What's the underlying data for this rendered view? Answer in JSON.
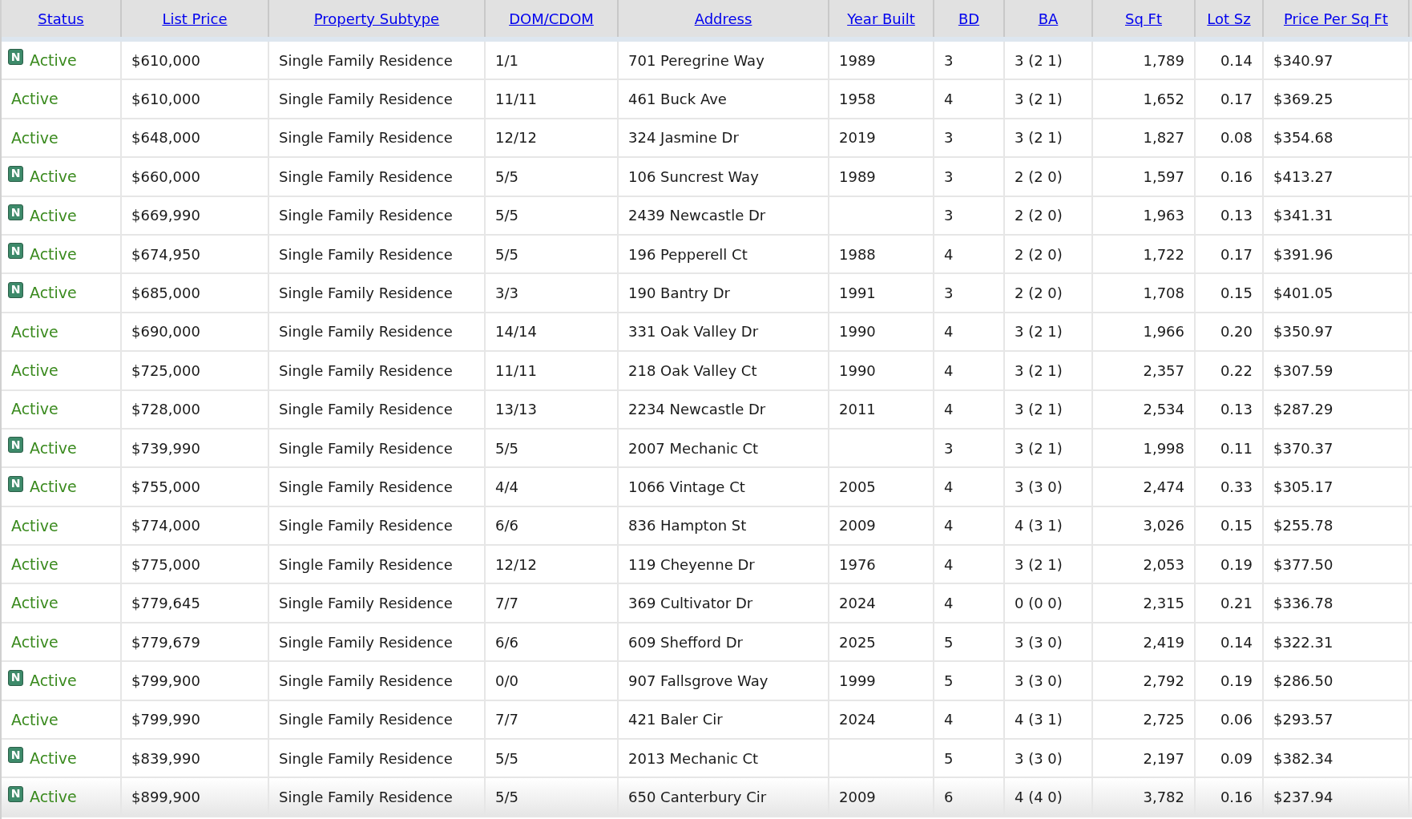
{
  "table": {
    "columns": [
      "Status",
      "List Price",
      "Property Subtype",
      "DOM/CDOM",
      "Address",
      "Year Built",
      "BD",
      "BA",
      "Sq Ft",
      "Lot Sz",
      "Price Per Sq Ft"
    ],
    "rows": [
      {
        "badge": "N",
        "status": "Active",
        "price": "$610,000",
        "subtype": "Single Family Residence",
        "dom": "1/1",
        "address": "701 Peregrine Way",
        "year": "1989",
        "bd": "3",
        "ba": "3 (2 1)",
        "sqft": "1,789",
        "lot": "0.14",
        "ppsf": "$340.97",
        "highlighted": false
      },
      {
        "status": "Active",
        "price": "$610,000",
        "subtype": "Single Family Residence",
        "dom": "11/11",
        "address": "461 Buck Ave",
        "year": "1958",
        "bd": "4",
        "ba": "3 (2 1)",
        "sqft": "1,652",
        "lot": "0.17",
        "ppsf": "$369.25",
        "highlighted": false
      },
      {
        "status": "Active",
        "price": "$648,000",
        "subtype": "Single Family Residence",
        "dom": "12/12",
        "address": "324 Jasmine Dr",
        "year": "2019",
        "bd": "3",
        "ba": "3 (2 1)",
        "sqft": "1,827",
        "lot": "0.08",
        "ppsf": "$354.68",
        "highlighted": false
      },
      {
        "badge": "N",
        "status": "Active",
        "price": "$660,000",
        "subtype": "Single Family Residence",
        "dom": "5/5",
        "address": "106 Suncrest Way",
        "year": "1989",
        "bd": "3",
        "ba": "2 (2 0)",
        "sqft": "1,597",
        "lot": "0.16",
        "ppsf": "$413.27",
        "highlighted": false
      },
      {
        "badge": "N",
        "status": "Active",
        "price": "$669,990",
        "subtype": "Single Family Residence",
        "dom": "5/5",
        "address": "2439 Newcastle Dr",
        "bd": "3",
        "ba": "2 (2 0)",
        "sqft": "1,963",
        "lot": "0.13",
        "ppsf": "$341.31",
        "highlighted": false
      },
      {
        "badge": "N",
        "status": "Active",
        "price": "$674,950",
        "subtype": "Single Family Residence",
        "dom": "5/5",
        "address": "196 Pepperell Ct",
        "year": "1988",
        "bd": "4",
        "ba": "2 (2 0)",
        "sqft": "1,722",
        "lot": "0.17",
        "ppsf": "$391.96",
        "highlighted": false
      },
      {
        "badge": "N",
        "status": "Active",
        "price": "$685,000",
        "subtype": "Single Family Residence",
        "dom": "3/3",
        "address": "190 Bantry Dr",
        "year": "1991",
        "bd": "3",
        "ba": "2 (2 0)",
        "sqft": "1,708",
        "lot": "0.15",
        "ppsf": "$401.05",
        "highlighted": false
      },
      {
        "status": "Active",
        "price": "$690,000",
        "subtype": "Single Family Residence",
        "dom": "14/14",
        "address": "331 Oak Valley Dr",
        "year": "1990",
        "bd": "4",
        "ba": "3 (2 1)",
        "sqft": "1,966",
        "lot": "0.20",
        "ppsf": "$350.97",
        "highlighted": false
      },
      {
        "status": "Active",
        "price": "$725,000",
        "subtype": "Single Family Residence",
        "dom": "11/11",
        "address": "218 Oak Valley Ct",
        "year": "1990",
        "bd": "4",
        "ba": "3 (2 1)",
        "sqft": "2,357",
        "lot": "0.22",
        "ppsf": "$307.59",
        "highlighted": false
      },
      {
        "status": "Active",
        "price": "$728,000",
        "subtype": "Single Family Residence",
        "dom": "13/13",
        "address": "2234 Newcastle Dr",
        "year": "2011",
        "bd": "4",
        "ba": "3 (2 1)",
        "sqft": "2,534",
        "lot": "0.13",
        "ppsf": "$287.29",
        "highlighted": false
      },
      {
        "badge": "N",
        "status": "Active",
        "price": "$739,990",
        "subtype": "Single Family Residence",
        "dom": "5/5",
        "address": "2007 Mechanic Ct",
        "bd": "3",
        "ba": "3 (2 1)",
        "sqft": "1,998",
        "lot": "0.11",
        "ppsf": "$370.37",
        "highlighted": false
      },
      {
        "badge": "N",
        "status": "Active",
        "price": "$755,000",
        "subtype": "Single Family Residence",
        "dom": "4/4",
        "address": "1066 Vintage Ct",
        "year": "2005",
        "bd": "4",
        "ba": "3 (3 0)",
        "sqft": "2,474",
        "lot": "0.33",
        "ppsf": "$305.17",
        "highlighted": false
      },
      {
        "status": "Active",
        "price": "$774,000",
        "subtype": "Single Family Residence",
        "dom": "6/6",
        "address": "836 Hampton St",
        "year": "2009",
        "bd": "4",
        "ba": "4 (3 1)",
        "sqft": "3,026",
        "lot": "0.15",
        "ppsf": "$255.78",
        "highlighted": false
      },
      {
        "status": "Active",
        "price": "$775,000",
        "subtype": "Single Family Residence",
        "dom": "12/12",
        "address": "119 Cheyenne Dr",
        "year": "1976",
        "bd": "4",
        "ba": "3 (2 1)",
        "sqft": "2,053",
        "lot": "0.19",
        "ppsf": "$377.50",
        "highlighted": false
      },
      {
        "status": "Active",
        "price": "$779,645",
        "subtype": "Single Family Residence",
        "dom": "7/7",
        "address": "369 Cultivator Dr",
        "year": "2024",
        "bd": "4",
        "ba": "0 (0 0)",
        "sqft": "2,315",
        "lot": "0.21",
        "ppsf": "$336.78",
        "highlighted": false
      },
      {
        "status": "Active",
        "price": "$779,679",
        "subtype": "Single Family Residence",
        "dom": "6/6",
        "address": "609 Shefford Dr",
        "year": "2025",
        "bd": "5",
        "ba": "3 (3 0)",
        "sqft": "2,419",
        "lot": "0.14",
        "ppsf": "$322.31",
        "highlighted": false
      },
      {
        "badge": "N",
        "status": "Active",
        "price": "$799,900",
        "subtype": "Single Family Residence",
        "dom": "0/0",
        "address": "907 Fallsgrove Way",
        "year": "1999",
        "bd": "5",
        "ba": "3 (3 0)",
        "sqft": "2,792",
        "lot": "0.19",
        "ppsf": "$286.50",
        "highlighted": false
      },
      {
        "status": "Active",
        "price": "$799,990",
        "subtype": "Single Family Residence",
        "dom": "7/7",
        "address": "421 Baler Cir",
        "year": "2024",
        "bd": "4",
        "ba": "4 (3 1)",
        "sqft": "2,725",
        "lot": "0.06",
        "ppsf": "$293.57",
        "highlighted": false
      },
      {
        "badge": "N",
        "status": "Active",
        "price": "$839,990",
        "subtype": "Single Family Residence",
        "dom": "5/5",
        "address": "2013 Mechanic Ct",
        "bd": "5",
        "ba": "3 (3 0)",
        "sqft": "2,197",
        "lot": "0.09",
        "ppsf": "$382.34",
        "highlighted": false
      },
      {
        "badge": "N",
        "status": "Active",
        "price": "$899,900",
        "subtype": "Single Family Residence",
        "dom": "5/5",
        "address": "650 Canterbury Cir",
        "year": "2009",
        "bd": "6",
        "ba": "4 (4 0)",
        "sqft": "3,782",
        "lot": "0.16",
        "ppsf": "$237.94",
        "highlighted": true
      }
    ]
  }
}
